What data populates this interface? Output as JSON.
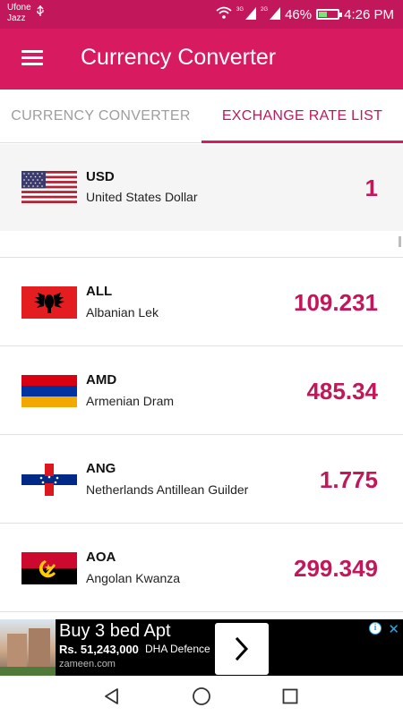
{
  "status_bar": {
    "carrier_line1": "Ufone",
    "carrier_line2": "Jazz",
    "net1": "3G",
    "net2": "2G",
    "battery": "46%",
    "battery_fraction": 0.46,
    "time": "4:26 PM"
  },
  "app_bar": {
    "title": "Currency Converter",
    "menu_icon": "hamburger-menu-icon"
  },
  "tabs": [
    {
      "label": "CURRENCY CONVERTER",
      "active": false
    },
    {
      "label": "EXCHANGE RATE LIST",
      "active": true
    }
  ],
  "colors": {
    "status_bar": "#c2185b",
    "app_bar": "#d81b60",
    "accent": "#c2185b",
    "inactive_tab": "#9e9e9e"
  },
  "base_currency": {
    "code": "USD",
    "name": "United States Dollar",
    "rate": "1",
    "flag": "us-flag-icon"
  },
  "rates": [
    {
      "code": "ALL",
      "name": "Albanian Lek",
      "rate": "109.231",
      "flag": "albania-flag-icon"
    },
    {
      "code": "AMD",
      "name": "Armenian Dram",
      "rate": "485.34",
      "flag": "armenia-flag-icon"
    },
    {
      "code": "ANG",
      "name": "Netherlands Antillean Guilder",
      "rate": "1.775",
      "flag": "netherlands-antilles-flag-icon"
    },
    {
      "code": "AOA",
      "name": "Angolan Kwanza",
      "rate": "299.349",
      "flag": "angola-flag-icon"
    }
  ],
  "ad": {
    "title": "Buy 3 bed Apt",
    "price": "Rs. 51,243,000",
    "location": "DHA Defence",
    "domain": "zameen.com"
  },
  "nav": {
    "back": "back-triangle-icon",
    "home": "home-circle-icon",
    "recents": "recents-square-icon"
  }
}
